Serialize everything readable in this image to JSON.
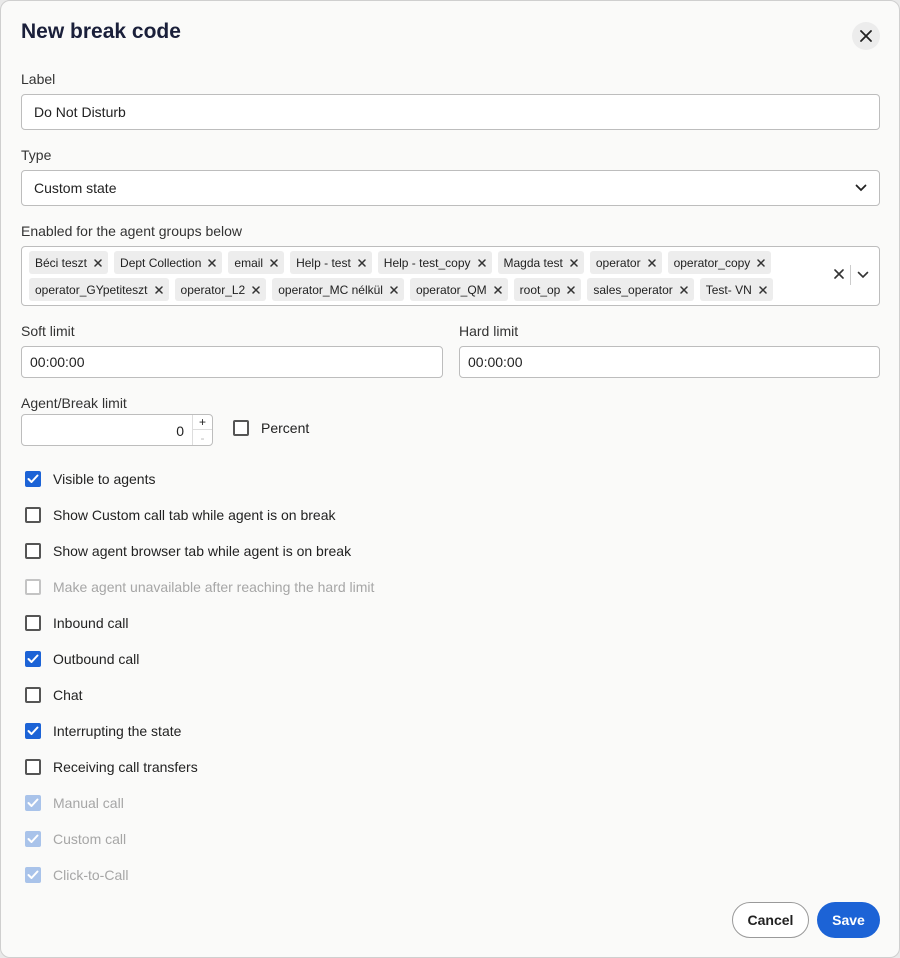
{
  "dialog": {
    "title": "New break code"
  },
  "label_field": {
    "label": "Label",
    "value": "Do Not Disturb"
  },
  "type_field": {
    "label": "Type",
    "value": "Custom state"
  },
  "groups_field": {
    "label": "Enabled for the agent groups below",
    "chips_row1": [
      "Béci teszt",
      "Dept Collection",
      "email",
      "Help - test",
      "Help - test_copy",
      "Magda test",
      "operator",
      "operator_copy"
    ],
    "chips_row2": [
      "operator_GYpetiteszt",
      "operator_L2",
      "operator_MC nélkül",
      "operator_QM",
      "root_op",
      "sales_operator",
      "Test- VN"
    ]
  },
  "soft_limit": {
    "label": "Soft limit",
    "value": "00:00:00"
  },
  "hard_limit": {
    "label": "Hard limit",
    "value": "00:00:00"
  },
  "agent_break_limit": {
    "label": "Agent/Break limit",
    "value": "0",
    "increment": "+",
    "decrement": "-"
  },
  "percent": {
    "label": "Percent",
    "checked": false
  },
  "options": [
    {
      "label": "Visible to agents",
      "checked": true,
      "disabled": false
    },
    {
      "label": "Show Custom call tab while agent is on break",
      "checked": false,
      "disabled": false
    },
    {
      "label": "Show agent browser tab while agent is on break",
      "checked": false,
      "disabled": false
    },
    {
      "label": "Make agent unavailable after reaching the hard limit",
      "checked": false,
      "disabled": true
    },
    {
      "label": "Inbound call",
      "checked": false,
      "disabled": false
    },
    {
      "label": "Outbound call",
      "checked": true,
      "disabled": false
    },
    {
      "label": "Chat",
      "checked": false,
      "disabled": false
    },
    {
      "label": "Interrupting the state",
      "checked": true,
      "disabled": false
    },
    {
      "label": "Receiving call transfers",
      "checked": false,
      "disabled": false
    },
    {
      "label": "Manual call",
      "checked": true,
      "disabled": true
    },
    {
      "label": "Custom call",
      "checked": true,
      "disabled": true
    },
    {
      "label": "Click-to-Call",
      "checked": true,
      "disabled": true
    }
  ],
  "footer": {
    "cancel_label": "Cancel",
    "save_label": "Save"
  },
  "colors": {
    "primary": "#1c63d6",
    "disabled_check": "#a9c3ea"
  }
}
